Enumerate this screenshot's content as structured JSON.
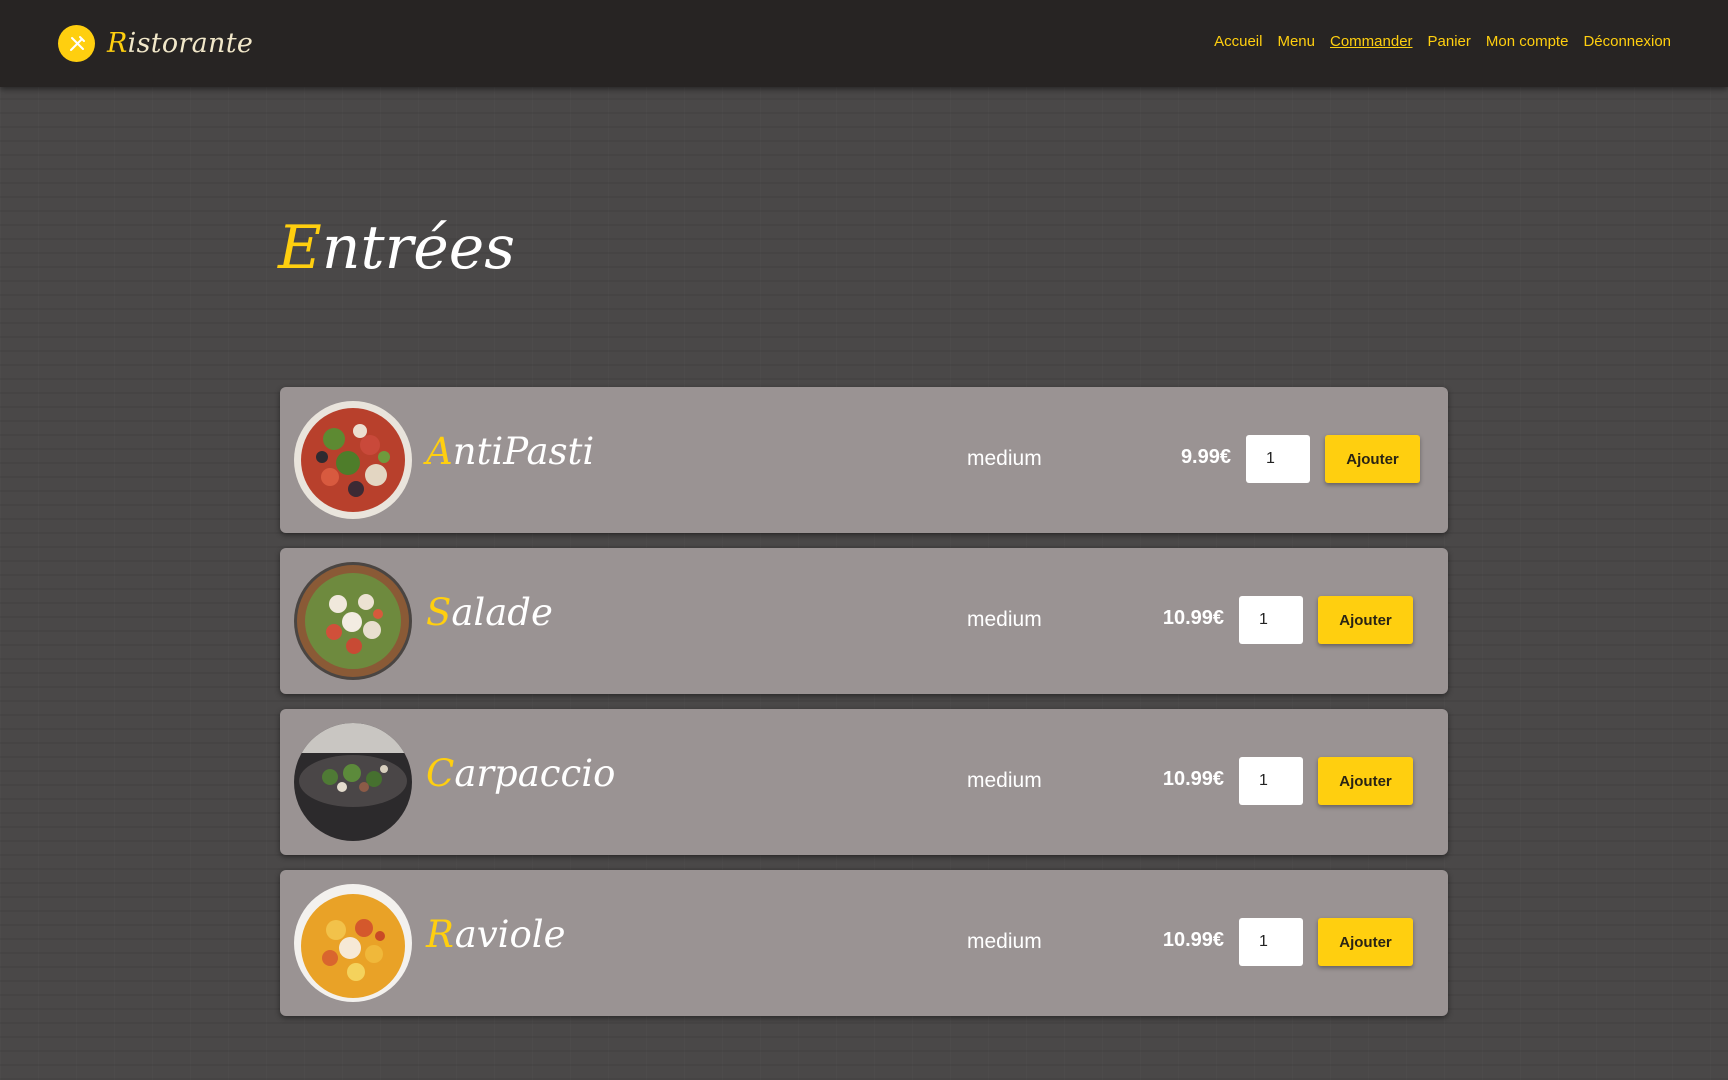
{
  "brand": {
    "initial": "R",
    "rest": "istorante",
    "accent_color": "#ffcf0f",
    "icon": "fork-knife-icon"
  },
  "nav": {
    "items": [
      {
        "label": "Accueil"
      },
      {
        "label": "Menu"
      },
      {
        "label": "Commander",
        "active": true
      },
      {
        "label": "Panier"
      },
      {
        "label": "Mon compte"
      },
      {
        "label": "Déconnexion"
      }
    ]
  },
  "section": {
    "title_initial": "E",
    "title_rest": "ntrées"
  },
  "items": [
    {
      "name_initial": "A",
      "name_rest": "ntiPasti",
      "size": "medium",
      "price": "9.99€",
      "qty": "1",
      "button": "Ajouter"
    },
    {
      "name_initial": "S",
      "name_rest": "alade",
      "size": "medium",
      "price": "10.99€",
      "qty": "1",
      "button": "Ajouter"
    },
    {
      "name_initial": "C",
      "name_rest": "arpaccio",
      "size": "medium",
      "price": "10.99€",
      "qty": "1",
      "button": "Ajouter"
    },
    {
      "name_initial": "R",
      "name_rest": "aviole",
      "size": "medium",
      "price": "10.99€",
      "qty": "1",
      "button": "Ajouter"
    }
  ],
  "colors": {
    "header_bg": "#272423",
    "card_bg": "#9a9393",
    "accent": "#ffcf0f"
  }
}
